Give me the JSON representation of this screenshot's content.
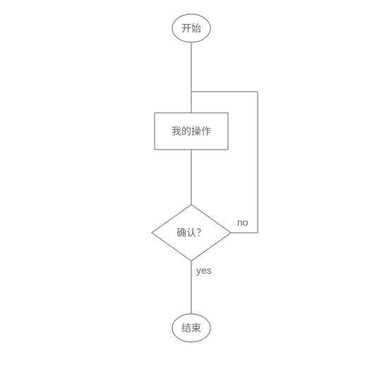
{
  "nodes": {
    "start": {
      "label": "开始"
    },
    "process": {
      "label": "我的操作"
    },
    "decision": {
      "label": "确认？"
    },
    "end": {
      "label": "结束"
    }
  },
  "edges": {
    "yes": {
      "label": "yes"
    },
    "no": {
      "label": "no"
    }
  }
}
